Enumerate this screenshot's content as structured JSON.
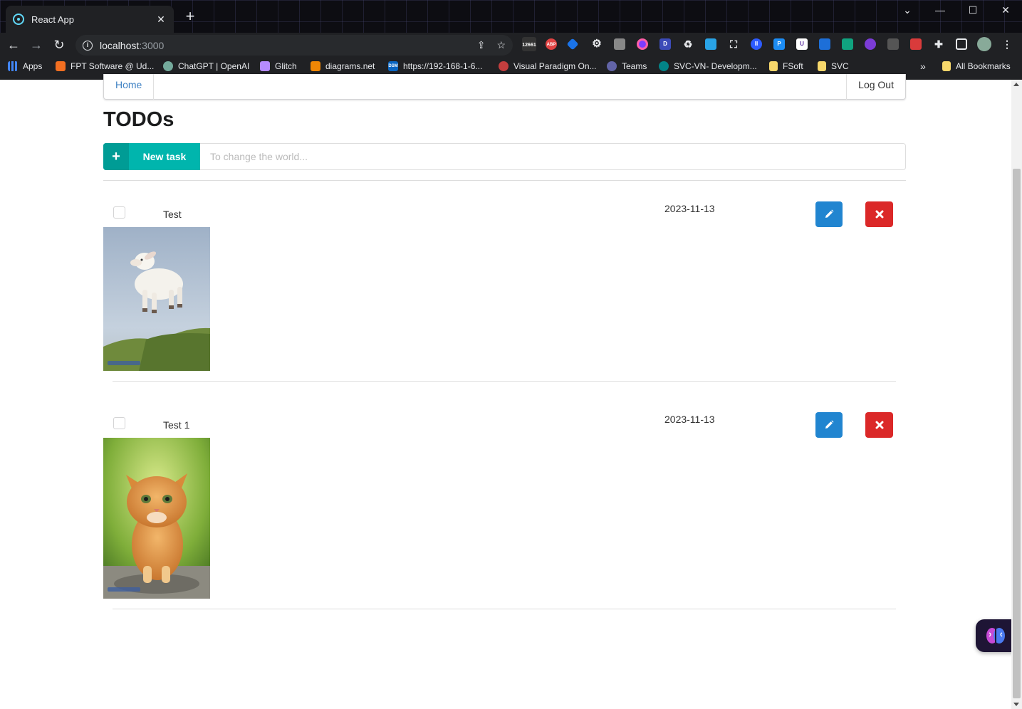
{
  "browser": {
    "tab_title": "React App",
    "url_host": "localhost",
    "url_port": ":3000",
    "extension_badge_count": "12661",
    "extension_abp": "ABP",
    "extension_dsm": "DSM",
    "bookmarks_overflow": "»",
    "bookmarks": [
      {
        "label": "Apps",
        "color": "#4285f4"
      },
      {
        "label": "FPT Software @ Ud...",
        "color": "#f36f21"
      },
      {
        "label": "ChatGPT | OpenAI",
        "color": "#74aa9c"
      },
      {
        "label": "Glitch",
        "color": "#b58bff"
      },
      {
        "label": "diagrams.net",
        "color": "#f08705"
      },
      {
        "label": "https://192-168-1-6...",
        "color": "#0a66c2"
      },
      {
        "label": "Visual Paradigm On...",
        "color": "#c33e3e"
      },
      {
        "label": "Teams",
        "color": "#6264a7"
      },
      {
        "label": "SVC-VN- Developm...",
        "color": "#038387"
      },
      {
        "label": "FSoft",
        "color": "#f6d76b"
      },
      {
        "label": "SVC",
        "color": "#f6d76b"
      },
      {
        "label": "All Bookmarks",
        "color": "#f6d76b"
      }
    ]
  },
  "nav": {
    "home": "Home",
    "logout": "Log Out"
  },
  "page": {
    "title": "TODOs"
  },
  "add": {
    "button_label": "New task",
    "plus": "+",
    "placeholder": "To change the world..."
  },
  "todos": [
    {
      "name": "Test",
      "date": "2023-11-13",
      "image": "jumping-lamb-photo",
      "completed": false
    },
    {
      "name": "Test 1",
      "date": "2023-11-13",
      "image": "orange-kitten-photo",
      "completed": false
    }
  ],
  "colors": {
    "teal": "#00b5ad",
    "blue": "#2185d0",
    "red": "#db2828",
    "link": "#4183c4"
  }
}
